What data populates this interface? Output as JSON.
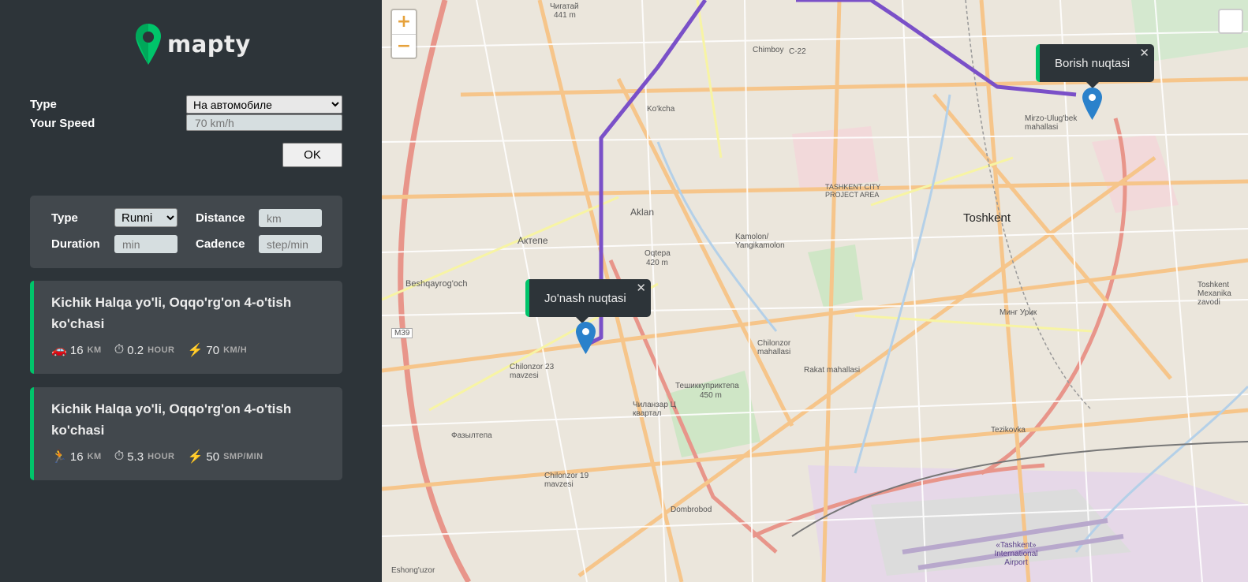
{
  "logo": {
    "text": "mapty"
  },
  "settings": {
    "type_label": "Type",
    "type_value": "На автомобиле",
    "speed_label": "Your Speed",
    "speed_placeholder": "70 km/h",
    "ok_label": "OK"
  },
  "form": {
    "type_label": "Type",
    "type_value": "Runni",
    "distance_label": "Distance",
    "distance_placeholder": "km",
    "duration_label": "Duration",
    "duration_placeholder": "min",
    "cadence_label": "Cadence",
    "cadence_placeholder": "step/min"
  },
  "workouts": [
    {
      "title": "Kichik Halqa yo'li, Oqqo'rg'on 4-o'tish ko'chasi",
      "type_icon": "car-icon",
      "distance": "16",
      "distance_unit": "KM",
      "duration": "0.2",
      "duration_unit": "HOUR",
      "speed": "70",
      "speed_unit": "KM/H"
    },
    {
      "title": "Kichik Halqa yo'li, Oqqo'rg'on 4-o'tish ko'chasi",
      "type_icon": "runner-icon",
      "distance": "16",
      "distance_unit": "KM",
      "duration": "5.3",
      "duration_unit": "HOUR",
      "speed": "50",
      "speed_unit": "SMP/MIN"
    }
  ],
  "map": {
    "zoom_in": "+",
    "zoom_out": "−",
    "popup_start": "Jo'nash nuqtasi",
    "popup_end": "Borish nuqtasi",
    "close_glyph": "✕",
    "accent_color": "#00c46a",
    "route_color": "#7a50c8",
    "labels": {
      "city": "Toshkent",
      "aklan": "Aklan",
      "aktepe": "Актепе",
      "beshqayrogoch": "Beshqayrog'och",
      "oqtepa": "Oqtepa",
      "oqtepa_alt": "420 m",
      "chilonzor": "Chilonzor mahallasi",
      "tashkent_city": "TASHKENT CITY PROJECT AREA",
      "mirzo": "Mirzo-Ulug'bek mahallasi",
      "tezikovka": "Tezikovka",
      "dombirobod": "Dombrobod",
      "rakat": "Rakat mahallasi",
      "airport": "«Tashkent» International Airport",
      "fazylatepa": "Фазылтепа",
      "chimboy": "Chimboy",
      "chigatay": "Чигатай",
      "chigatay_alt": "441 m",
      "eshongu": "Eshong'uzor",
      "m39": "M39",
      "c22": "C-22",
      "tashkent_alt": "Тешиккуприктепа",
      "tashkent_alt_m": "450 m",
      "mingorik": "Минг Урик",
      "kokcha": "Ko'kcha",
      "kamolon": "Kamolon/ Yangikamolon",
      "chilonzor23": "Chilonzor 23 mavzesi",
      "chilonzor19": "Chilonzor 19 mavzesi",
      "chilanzar_c": "Чиланзар Ц квартал",
      "toshkent_mex": "Toshkent Mexanika zavodi"
    }
  }
}
